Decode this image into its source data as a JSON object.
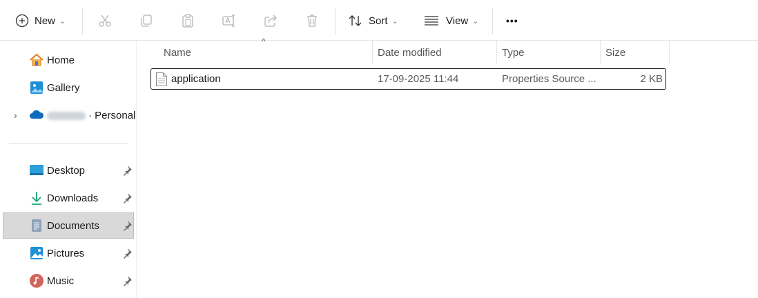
{
  "toolbar": {
    "new_label": "New",
    "sort_label": "Sort",
    "view_label": "View",
    "more_label": "•••"
  },
  "sidebar": {
    "items": [
      {
        "label": "Home"
      },
      {
        "label": "Gallery"
      },
      {
        "label": "· Personal"
      },
      {
        "label": "Desktop"
      },
      {
        "label": "Downloads"
      },
      {
        "label": "Documents"
      },
      {
        "label": "Pictures"
      },
      {
        "label": "Music"
      }
    ]
  },
  "columns": {
    "name": "Name",
    "date": "Date modified",
    "type": "Type",
    "size": "Size"
  },
  "files": [
    {
      "name": "application",
      "date": "17-09-2025 11:44",
      "type": "Properties Source ...",
      "size": "2 KB"
    }
  ],
  "colors": {
    "accent": "#0067c0",
    "selected_bg": "#d9d9d9"
  }
}
